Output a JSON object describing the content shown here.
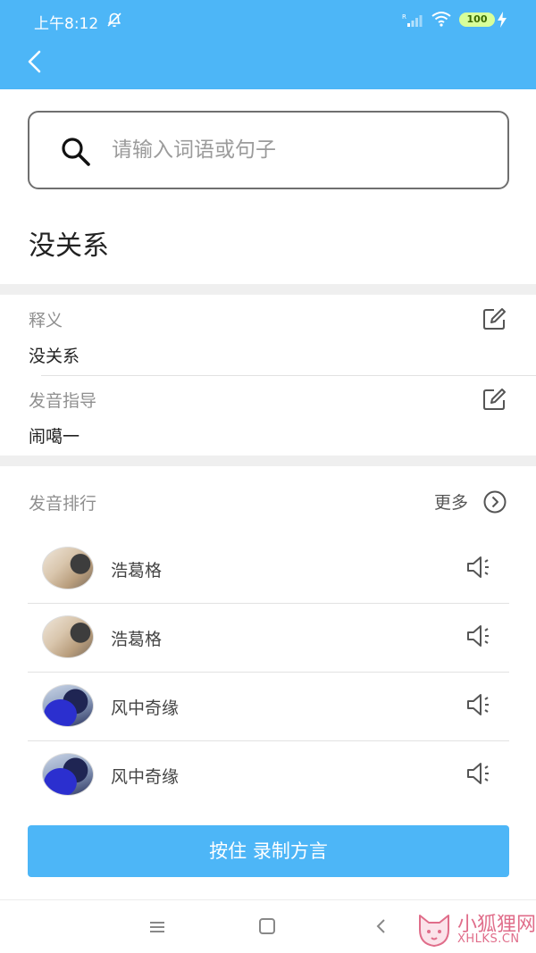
{
  "status_bar": {
    "time": "上午8:12",
    "battery": "100"
  },
  "search": {
    "placeholder": "请输入词语或句子"
  },
  "word": {
    "title": "没关系"
  },
  "definition": {
    "label": "释义",
    "value": "没关系"
  },
  "pronunciation_guide": {
    "label": "发音指导",
    "value": "闹噶一"
  },
  "ranking": {
    "label": "发音排行",
    "more_label": "更多",
    "items": [
      {
        "name": "浩葛格",
        "avatar": "beige-photo"
      },
      {
        "name": "浩葛格",
        "avatar": "beige-photo"
      },
      {
        "name": "风中奇缘",
        "avatar": "blue-photo"
      },
      {
        "name": "风中奇缘",
        "avatar": "blue-photo"
      }
    ]
  },
  "record_button": {
    "label": "按住  录制方言"
  },
  "watermark": {
    "title": "小狐狸网",
    "subtitle": "XHLKS.CN"
  },
  "colors": {
    "accent": "#4db6f7",
    "watermark": "#e06d8a"
  },
  "icons": [
    "bell-off-icon",
    "signal-icon",
    "wifi-icon",
    "battery-icon",
    "charging-icon",
    "back-arrow-icon",
    "search-icon",
    "edit-icon",
    "chevron-right-circle-icon",
    "speaker-icon",
    "menu-icon",
    "home-icon",
    "nav-back-icon"
  ]
}
